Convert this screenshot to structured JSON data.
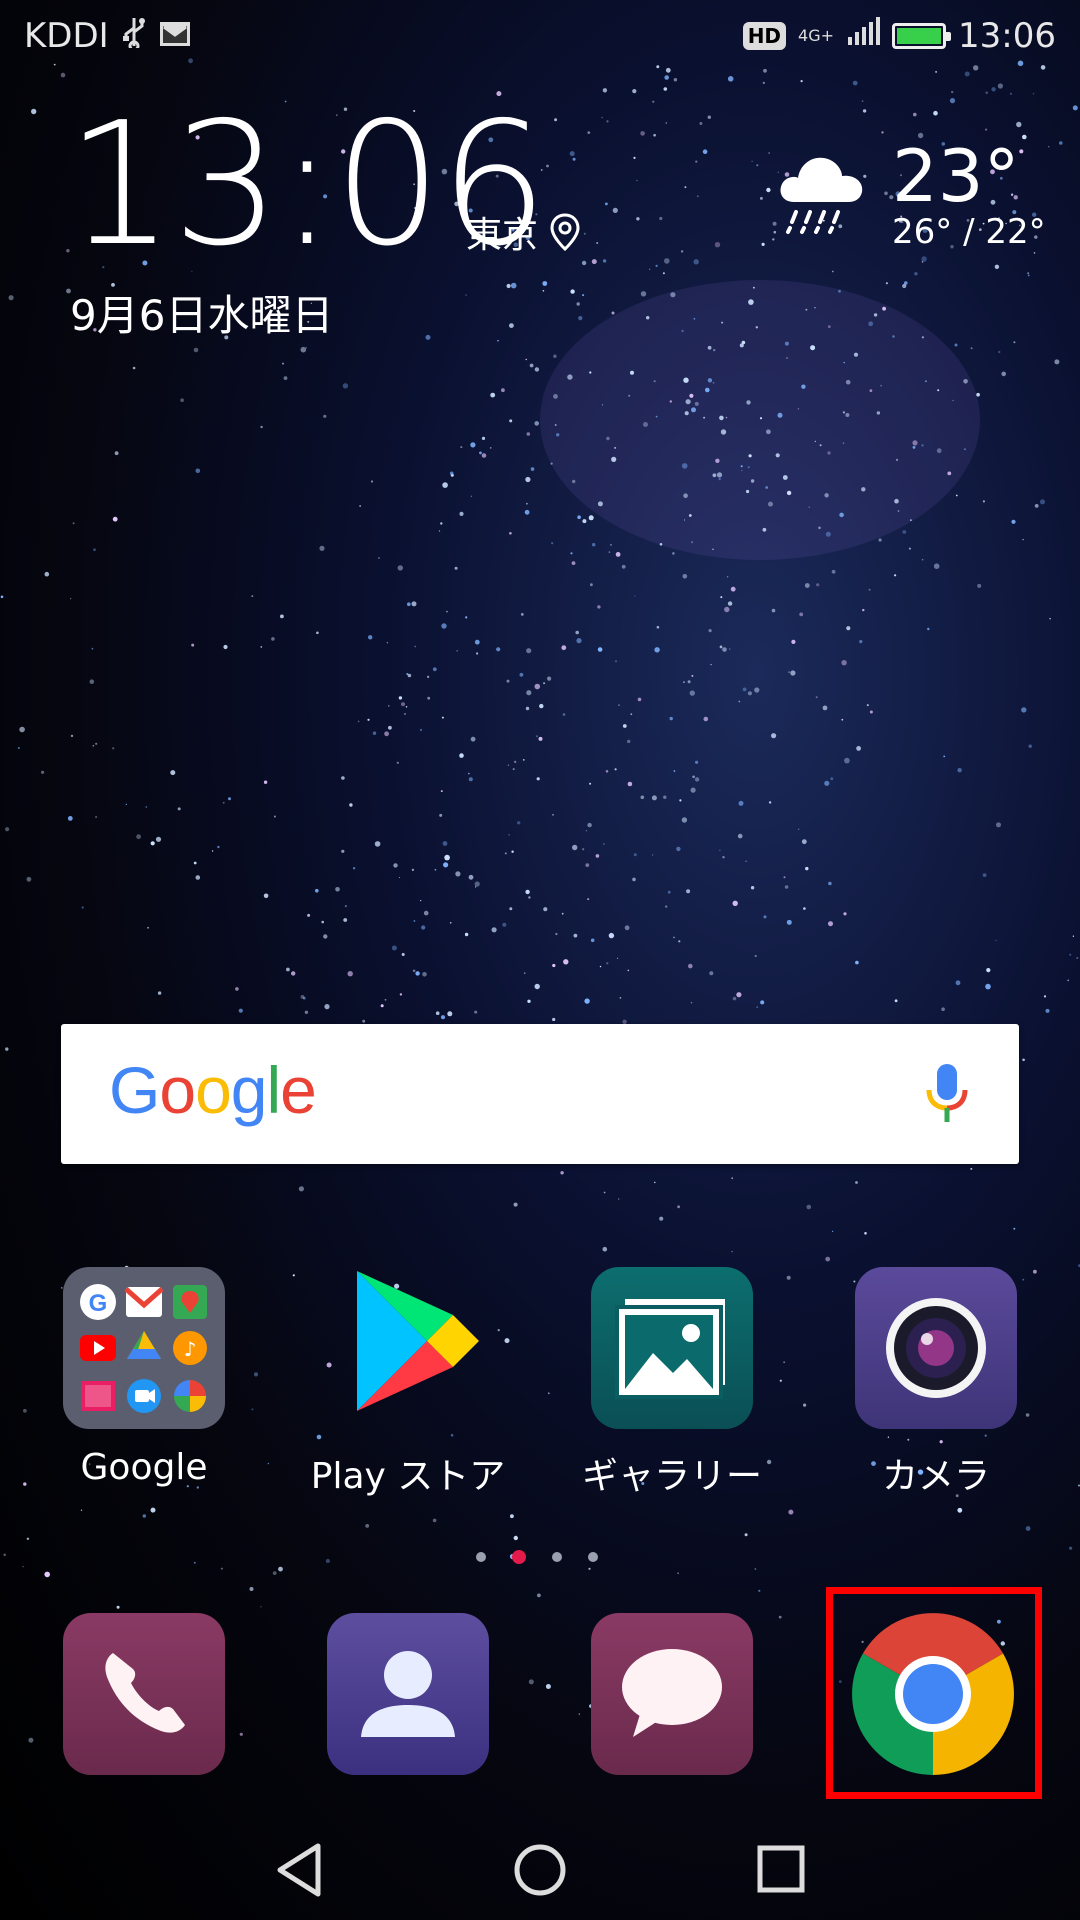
{
  "status_bar": {
    "carrier": "KDDI",
    "hd": "HD",
    "network": "4G+",
    "time": "13:06",
    "left_icons": [
      "usb-icon",
      "gmail-icon"
    ],
    "right_icons": [
      "signal-icon",
      "battery-charging-icon"
    ]
  },
  "clock_widget": {
    "time": "13:06",
    "city": "東京",
    "date": "9月6日水曜日"
  },
  "weather": {
    "condition_icon": "rain-cloud-icon",
    "temperature": "23°",
    "range": "26° / 22°"
  },
  "search_bar": {
    "logo_text": "Google",
    "logo_colors": [
      "#4285F4",
      "#EA4335",
      "#FBBC05",
      "#4285F4",
      "#34A853",
      "#EA4335"
    ],
    "mic_icon": "mic-icon"
  },
  "apps": [
    {
      "label": "Google",
      "icon": "google-folder-icon"
    },
    {
      "label": "Play ストア",
      "icon": "play-store-icon"
    },
    {
      "label": "ギャラリー",
      "icon": "gallery-icon"
    },
    {
      "label": "カメラ",
      "icon": "camera-icon"
    }
  ],
  "page_indicator": {
    "count": 4,
    "active_index": 1,
    "active_color": "#e31b4a"
  },
  "dock": [
    {
      "name": "phone",
      "icon": "phone-icon"
    },
    {
      "name": "contacts",
      "icon": "contacts-icon"
    },
    {
      "name": "messages",
      "icon": "messages-icon"
    },
    {
      "name": "chrome",
      "icon": "chrome-icon"
    }
  ],
  "highlight_color": "#ff0000",
  "nav_bar": [
    "back-icon",
    "home-icon",
    "recents-icon"
  ]
}
